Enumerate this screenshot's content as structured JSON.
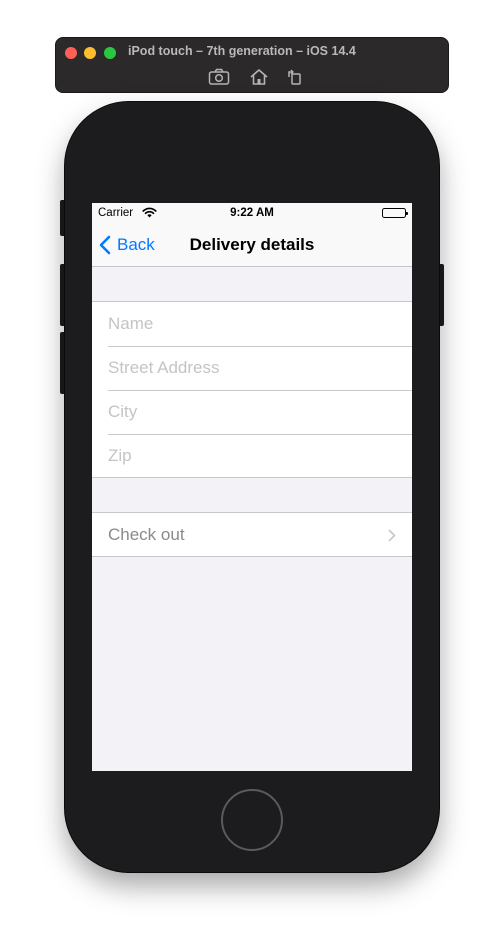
{
  "simulator": {
    "title": "iPod touch – 7th generation – iOS 14.4",
    "toolbar": [
      "screenshot-icon",
      "home-icon",
      "rotate-icon"
    ]
  },
  "status_bar": {
    "carrier": "Carrier",
    "time": "9:22 AM"
  },
  "nav": {
    "back_label": "Back",
    "title": "Delivery details"
  },
  "form": {
    "fields": [
      {
        "placeholder": "Name",
        "value": ""
      },
      {
        "placeholder": "Street Address",
        "value": ""
      },
      {
        "placeholder": "City",
        "value": ""
      },
      {
        "placeholder": "Zip",
        "value": ""
      }
    ]
  },
  "actions": {
    "checkout_label": "Check out"
  },
  "colors": {
    "accent": "#007aff",
    "grouped_background": "#f2f2f7",
    "placeholder": "#c4c4c6",
    "device_body": "#1c1c1e"
  }
}
